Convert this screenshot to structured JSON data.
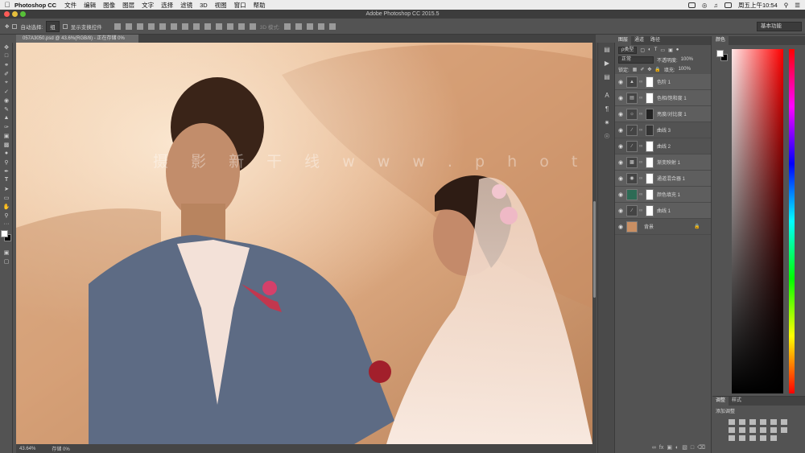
{
  "mac": {
    "app": "Photoshop CC",
    "menus": [
      "文件",
      "编辑",
      "图像",
      "图层",
      "文字",
      "选择",
      "滤镜",
      "3D",
      "视图",
      "窗口",
      "帮助"
    ],
    "clock": "周五上午10:54"
  },
  "window": {
    "title": "Adobe Photoshop CC 2015.5"
  },
  "options": {
    "auto_select_label": "自动选择:",
    "auto_select_value": "组",
    "show_transform_label": "显示变换控件",
    "mode_3d_label": "3D 模式:",
    "workspace": "基本功能"
  },
  "document": {
    "tab": "057A3050.psd @ 43.6%(RGB/8) - 正在存储 0%",
    "watermark": "摄 影 新 干 线   w w w . p h o t o s k s . v i p",
    "zoom": "43.64%",
    "status": "存储 0%"
  },
  "layers_panel": {
    "tabs": [
      "图层",
      "通道",
      "路径"
    ],
    "filter_kind": "ρ类型",
    "blend_mode": "正常",
    "opacity_label": "不透明度:",
    "opacity_value": "100%",
    "lock_label": "锁定:",
    "fill_label": "填充:",
    "fill_value": "100%",
    "layers": [
      {
        "name": "色阶 1",
        "thumb": "levels"
      },
      {
        "name": "色相/饱和度 1",
        "thumb": "hue"
      },
      {
        "name": "亮度/对比度 1",
        "thumb": "brightness"
      },
      {
        "name": "曲线 3",
        "thumb": "curves"
      },
      {
        "name": "曲线 2",
        "thumb": "curves"
      },
      {
        "name": "渐变映射 1",
        "thumb": "gradient"
      },
      {
        "name": "通道混合器 1",
        "thumb": "mixer"
      },
      {
        "name": "颜色填充 1",
        "thumb": "fill"
      },
      {
        "name": "曲线 1",
        "thumb": "curves"
      },
      {
        "name": "背景",
        "thumb": "photo"
      }
    ]
  },
  "color_panel": {
    "tab": "颜色"
  },
  "adjust_panel": {
    "tabs": [
      "调整",
      "样式"
    ],
    "add_label": "添加调整"
  },
  "colors": {
    "fill_layer": "#2d6b55",
    "foreground": "#ffffff",
    "background": "#000000"
  }
}
